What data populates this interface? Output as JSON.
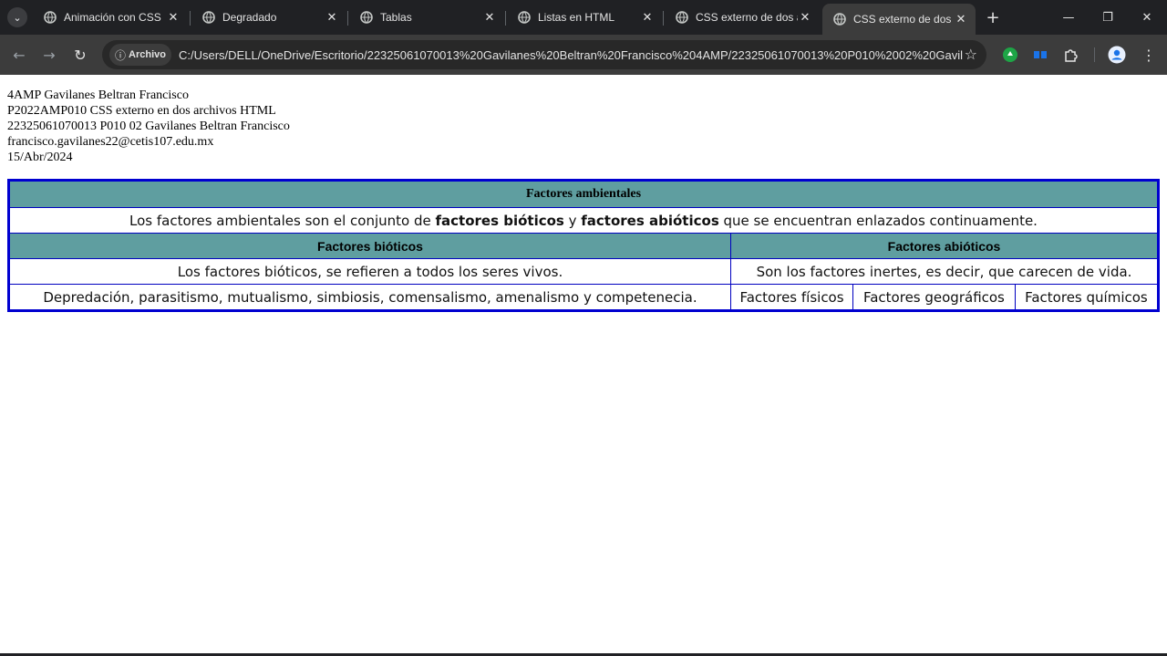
{
  "browser": {
    "tabs": [
      {
        "title": "Animación con CSS",
        "active": false
      },
      {
        "title": "Degradado",
        "active": false
      },
      {
        "title": "Tablas",
        "active": false
      },
      {
        "title": "Listas en HTML",
        "active": false
      },
      {
        "title": "CSS externo de dos a",
        "active": false
      },
      {
        "title": "CSS externo de dos a",
        "active": true
      }
    ],
    "omnibox": {
      "chip_label": "Archivo",
      "url": "C:/Users/DELL/OneDrive/Escritorio/22325061070013%20Gavilanes%20Beltran%20Francisco%204AMP/22325061070013%20P010%2002%20Gavila..."
    },
    "icons": {
      "back": "back-arrow-icon",
      "forward": "forward-arrow-icon",
      "reload": "reload-icon",
      "bookmark": "star-icon",
      "extensions": "puzzle-icon",
      "profile": "profile-icon",
      "menu": "kebab-menu-icon"
    },
    "colors": {
      "tabstrip": "#202124",
      "toolbar": "#3c3c3c",
      "omnibox": "#282828"
    }
  },
  "page": {
    "info_lines": [
      "4AMP Gavilanes Beltran Francisco",
      "P2022AMP010 CSS externo en dos archivos HTML",
      "22325061070013 P010 02 Gavilanes Beltran Francisco",
      "francisco.gavilanes22@cetis107.edu.mx",
      "15/Abr/2024"
    ],
    "table": {
      "title": "Factores ambientales",
      "description": {
        "pre": "Los factores ambientales son el conjunto de ",
        "bold1": "factores bióticos",
        "mid": " y ",
        "bold2": "factores abióticos",
        "post": " que se encuentran enlazados continuamente."
      },
      "header_bioticos": "Factores bióticos",
      "header_abioticos": "Factores abióticos",
      "bioticos_desc": "Los factores bióticos, se refieren a todos los seres vivos.",
      "abioticos_desc": "Son los factores inertes, es decir, que carecen de vida.",
      "bioticos_examples": "Depredación, parasitismo, mutualismo, simbiosis, comensalismo, amenalismo y competenecia.",
      "abioticos_types": [
        "Factores físicos",
        "Factores geográficos",
        "Factores químicos"
      ],
      "colors": {
        "header_bg": "#5f9ea0",
        "border": "#0000d0"
      }
    }
  }
}
